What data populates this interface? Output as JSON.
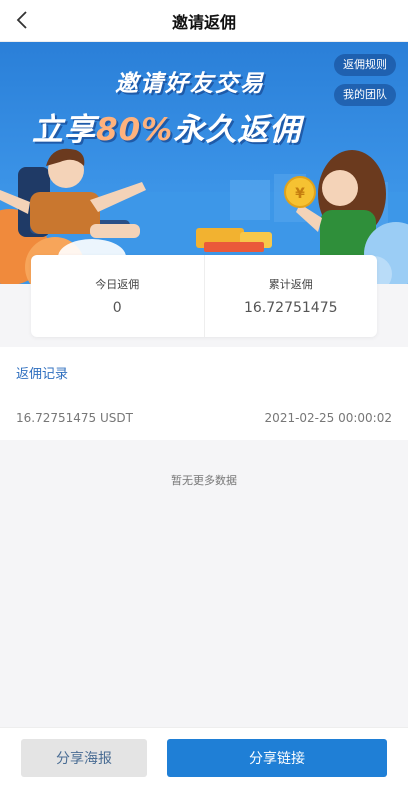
{
  "header": {
    "title": "邀请返佣"
  },
  "banner": {
    "headline_1": "邀请好友交易",
    "headline_2_prefix": "立享",
    "headline_2_accent": "80%",
    "headline_2_suffix": "永久返佣",
    "rules_label": "返佣规则",
    "team_label": "我的团队"
  },
  "stats": {
    "today_label": "今日返佣",
    "today_value": "0",
    "total_label": "累计返佣",
    "total_value": "16.72751475"
  },
  "records": {
    "title": "返佣记录",
    "items": [
      {
        "amount": "16.72751475 USDT",
        "date": "2021-02-25 00:00:02"
      }
    ]
  },
  "empty_hint": "暂无更多数据",
  "footer": {
    "poster_label": "分享海报",
    "link_label": "分享链接"
  },
  "colors": {
    "primary": "#1f7fd6",
    "accent": "#ffb27d",
    "link_text": "#2f6fbf"
  }
}
